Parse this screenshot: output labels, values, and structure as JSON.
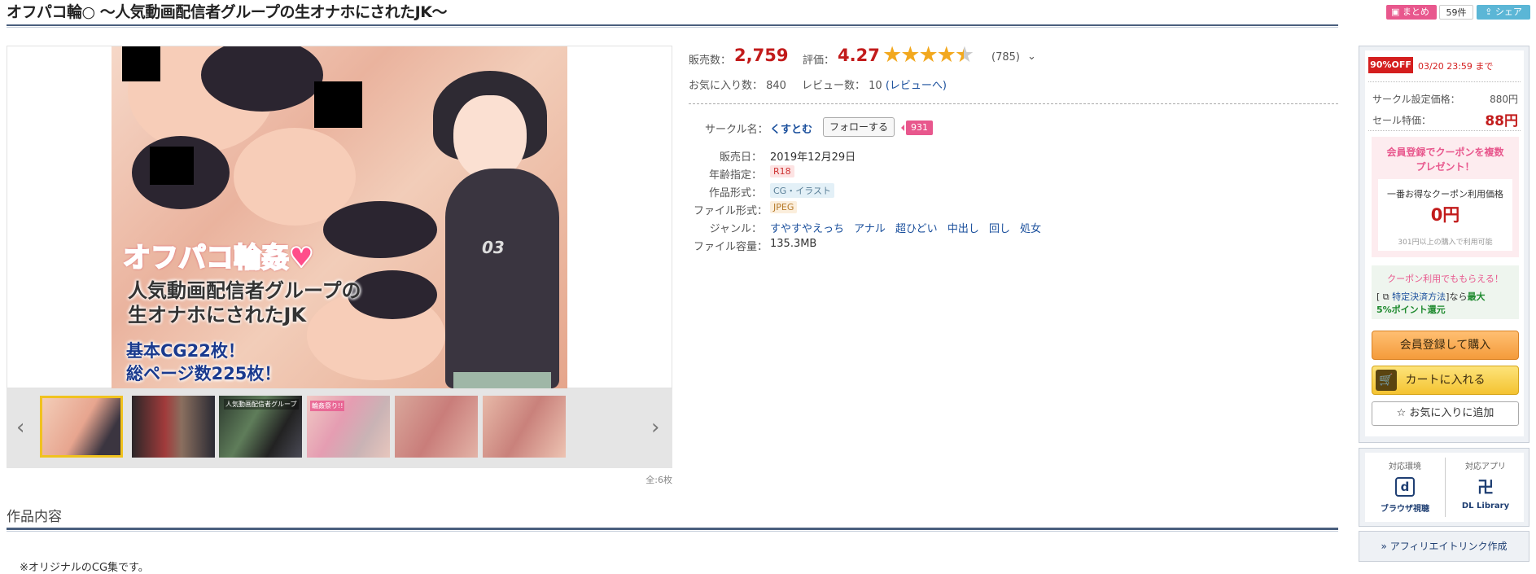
{
  "header": {
    "title": "オフパコ輪○ ～人気動画配信者グループの生オナホにされたJK～",
    "matome_label": "まとめ",
    "matome_count": "59件",
    "share_label": "シェア"
  },
  "artwork": {
    "title_line1": "オフパコ輪姦♥",
    "title_line2": "人気動画配信者グループの",
    "title_line3": "生オナホにされたJK",
    "sub_line1": "基本CG22枚！",
    "sub_line2": "総ページ数225枚！",
    "jersey": "03"
  },
  "thumbnails": {
    "items": [
      {
        "caption": ""
      },
      {
        "caption": ""
      },
      {
        "caption": "人気動画配信者グループ"
      },
      {
        "caption": "輪姦祭り!!"
      },
      {
        "caption": ""
      },
      {
        "caption": ""
      }
    ],
    "total": "全:6枚",
    "prev_glyph": "‹",
    "next_glyph": "›"
  },
  "stats": {
    "sales_label": "販売数：",
    "sales_value": "2,759",
    "rating_label": "評価：",
    "rating_value": "4.27",
    "rating_stars": 4.27,
    "rating_count": "(785)",
    "favorites_label": "お気に入り数： 840",
    "reviews_label": "レビュー数： 10",
    "reviews_link": "(レビューへ)"
  },
  "details": {
    "circle_label": "サークル名：",
    "circle_name": "くすとむ",
    "follow_label": "フォローする",
    "follow_count": "931",
    "rows": [
      {
        "label": "販売日：",
        "value": "2019年12月29日"
      },
      {
        "label": "年齢指定：",
        "value": "R18"
      },
      {
        "label": "作品形式：",
        "value": "CG・イラスト"
      },
      {
        "label": "ファイル形式：",
        "value": "JPEG"
      },
      {
        "label": "ジャンル：",
        "genres": [
          "すやすやえっち",
          "アナル",
          "超ひどい",
          "中出し",
          "回し",
          "処女"
        ]
      },
      {
        "label": "ファイル容量：",
        "value": "135.3MB"
      }
    ]
  },
  "section": {
    "title": "作品内容",
    "desc": "※オリジナルのCG集です。"
  },
  "panel": {
    "discount_badge": "90%OFF",
    "sale_end": "03/20 23:59 まで",
    "list_price_label": "サークル設定価格：",
    "list_price": "880円",
    "sale_price_label": "セール特価：",
    "sale_price": "88円",
    "coupon_title1": "会員登録でクーポンを複数",
    "coupon_title2": "プレゼント！",
    "coupon_label": "一番お得なクーポン利用価格",
    "coupon_price": "0円",
    "coupon_note": "301円以上の購入で利用可能",
    "pay_title": "クーポン利用でももらえる！",
    "pay_line1_prefix": "[",
    "pay_method_link": "特定決済方法",
    "pay_line1_suffix": "]なら",
    "pay_line1_highlight": "最大",
    "pay_line2": "5%ポイント還元",
    "buy_label": "会員登録して購入",
    "cart_label": "カートに入れる",
    "fav_label": "お気に入りに追加",
    "compat_env_head": "対応環境",
    "compat_app_head": "対応アプリ",
    "compat_env_caption": "ブラウザ視聴",
    "compat_app_caption": "DL Library",
    "affiliate_label": "» アフィリエイトリンク作成"
  },
  "colors": {
    "accent_pink": "#e8578d",
    "price_red": "#c21b1b",
    "link_blue": "#1a4f9c",
    "rule_navy": "#4a5f7e"
  }
}
